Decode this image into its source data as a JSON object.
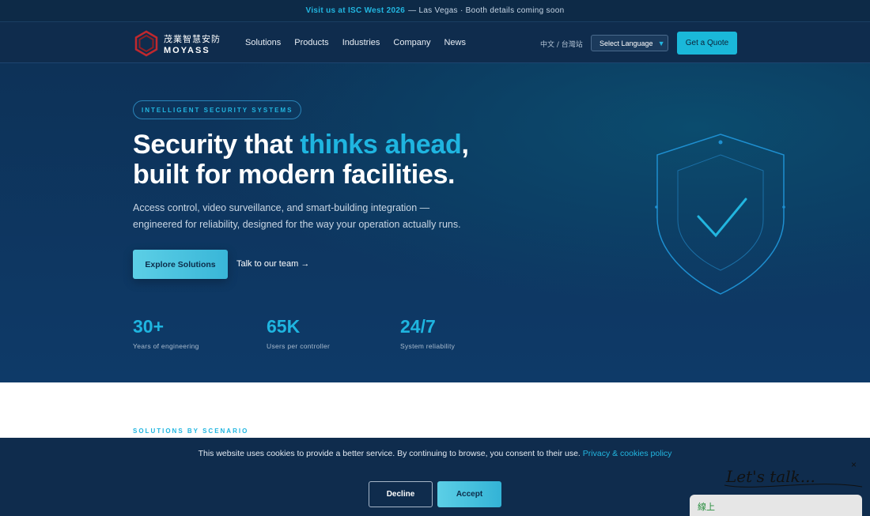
{
  "announcement": {
    "highlight": "Visit us at ISC West 2026",
    "rest": "— Las Vegas · Booth details coming soon"
  },
  "nav": {
    "logo_cn": "茂業智慧安防",
    "logo_en": "MOYASS",
    "menu": [
      "Solutions",
      "Products",
      "Industries",
      "Company",
      "News"
    ],
    "locale": "中文 / 台灣站",
    "language_select": "Select Language",
    "quote_button": "Get a Quote"
  },
  "hero": {
    "kicker": "INTELLIGENT SECURITY SYSTEMS",
    "headline_part1": "Security that ",
    "headline_accent": "thinks ahead",
    "headline_part2": ",",
    "headline_line2": "built for modern facilities.",
    "subtext": "Access control, video surveillance, and smart-building integration — engineered for reliability, designed for the way your operation actually runs.",
    "primary_button": "Explore Solutions",
    "secondary_link": "Talk to our team →",
    "stats": [
      {
        "value": "30+",
        "label": "Years of engineering"
      },
      {
        "value": "65K",
        "label": "Users per controller"
      },
      {
        "value": "24/7",
        "label": "System reliability"
      }
    ]
  },
  "section": {
    "label": "SOLUTIONS BY SCENARIO"
  },
  "cookie": {
    "text": "This website uses cookies to provide a better service. By continuing to browse, you consent to their use.",
    "policy_link": "Privacy & cookies policy",
    "decline": "Decline",
    "accept": "Accept"
  },
  "chat": {
    "close": "×",
    "script": "Let's talk...",
    "status": "線上"
  },
  "colors": {
    "accent": "#1fb5e0",
    "navy": "#0f2c4d",
    "logo_red": "#c0282e"
  }
}
